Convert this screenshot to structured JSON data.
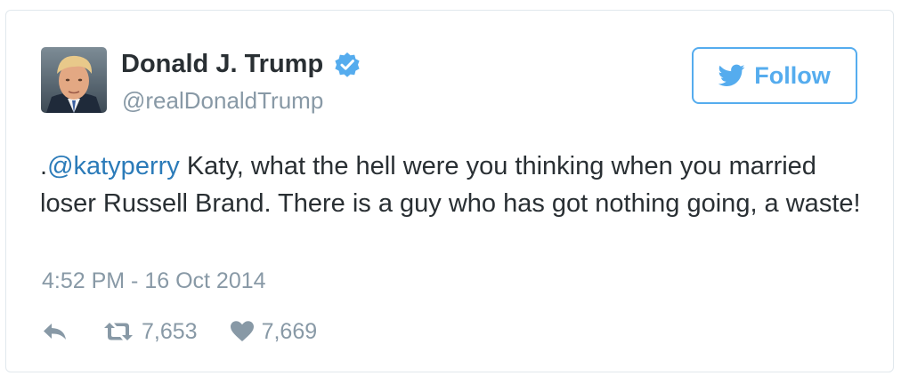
{
  "user": {
    "display_name": "Donald J. Trump",
    "handle": "@realDonaldTrump",
    "verified": true,
    "avatar_icon": "profile-photo"
  },
  "follow_button": {
    "label": "Follow",
    "icon": "twitter-bird-icon"
  },
  "tweet": {
    "prefix": ".",
    "mention": "@katyperry",
    "text": " Katy, what the hell were you thinking when you married loser Russell Brand. There is a guy who has got nothing going, a waste!",
    "timestamp": "4:52 PM - 16 Oct 2014"
  },
  "actions": {
    "reply_icon": "reply-icon",
    "retweet_icon": "retweet-icon",
    "retweets": "7,653",
    "like_icon": "heart-icon",
    "likes": "7,669"
  },
  "colors": {
    "accent": "#55acee",
    "mention": "#2b7bb9",
    "muted": "#8899a6",
    "text": "#292f33",
    "border": "#e1e8ed"
  }
}
